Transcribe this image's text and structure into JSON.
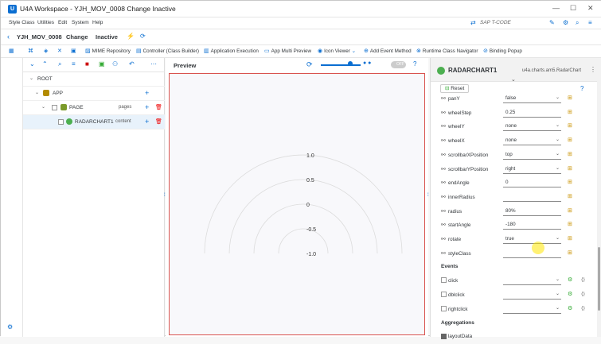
{
  "window": {
    "title": "U4A Workspace - YJH_MOV_0008 Change Inactive",
    "logo_letter": "U"
  },
  "menu": [
    "Style Class",
    "Utilities",
    "Edit",
    "System",
    "Help"
  ],
  "tcode": "SAP T-CODE",
  "header": {
    "app_id": "YJH_MOV_0008",
    "mode": "Change",
    "status": "Inactive"
  },
  "toolbar": {
    "mime": "MIME Repository",
    "controller": "Controller (Class Builder)",
    "app_exec": "Application Execution",
    "multi_preview": "App Multi Preview",
    "icon_viewer": "Icon Viewer",
    "add_event": "Add Event Method",
    "runtime_nav": "Runtime Class Navigator",
    "binding_popup": "Binding Popup"
  },
  "tree": {
    "root": "ROOT",
    "app": "APP",
    "page": "PAGE",
    "page_agg": "pages",
    "radar": "RADARCHART1",
    "radar_agg": "content"
  },
  "preview": {
    "title": "Preview",
    "toggle": "OFF",
    "axis_labels": [
      "1.0",
      "0.5",
      "0",
      "-0.5",
      "-1.0"
    ]
  },
  "chart_data": {
    "type": "radar",
    "start_angle": -180,
    "end_angle": 0,
    "ticks": [
      1.0,
      0.5,
      0,
      -0.5,
      -1.0
    ],
    "ylim": [
      -1.0,
      1.0
    ]
  },
  "props": {
    "control": "RADARCHART1",
    "control_type": "u4a.charts.am5.RadarChart",
    "reset": "Reset",
    "rows": [
      {
        "name": "panY",
        "value": "false",
        "dropdown": true
      },
      {
        "name": "wheelStep",
        "value": "0.25",
        "dropdown": false
      },
      {
        "name": "wheelY",
        "value": "none",
        "dropdown": true
      },
      {
        "name": "wheelX",
        "value": "none",
        "dropdown": true
      },
      {
        "name": "scrollbarXPosition",
        "value": "top",
        "dropdown": true
      },
      {
        "name": "scrollbarYPosition",
        "value": "right",
        "dropdown": true
      },
      {
        "name": "endAngle",
        "value": "0",
        "dropdown": false
      },
      {
        "name": "innerRadius",
        "value": "",
        "dropdown": false
      },
      {
        "name": "radius",
        "value": "80%",
        "dropdown": false
      },
      {
        "name": "startAngle",
        "value": "-180",
        "dropdown": false
      },
      {
        "name": "rotate",
        "value": "true",
        "dropdown": true
      },
      {
        "name": "styleClass",
        "value": "",
        "dropdown": false
      }
    ],
    "events_label": "Events",
    "events": [
      "click",
      "dblclick",
      "rightclick"
    ],
    "aggregations_label": "Aggregations",
    "aggregations": [
      "layoutData"
    ]
  },
  "colors": {
    "accent": "#0a6ed1",
    "selected_row": "#e8f2fb",
    "preview_border": "#d9534f"
  }
}
